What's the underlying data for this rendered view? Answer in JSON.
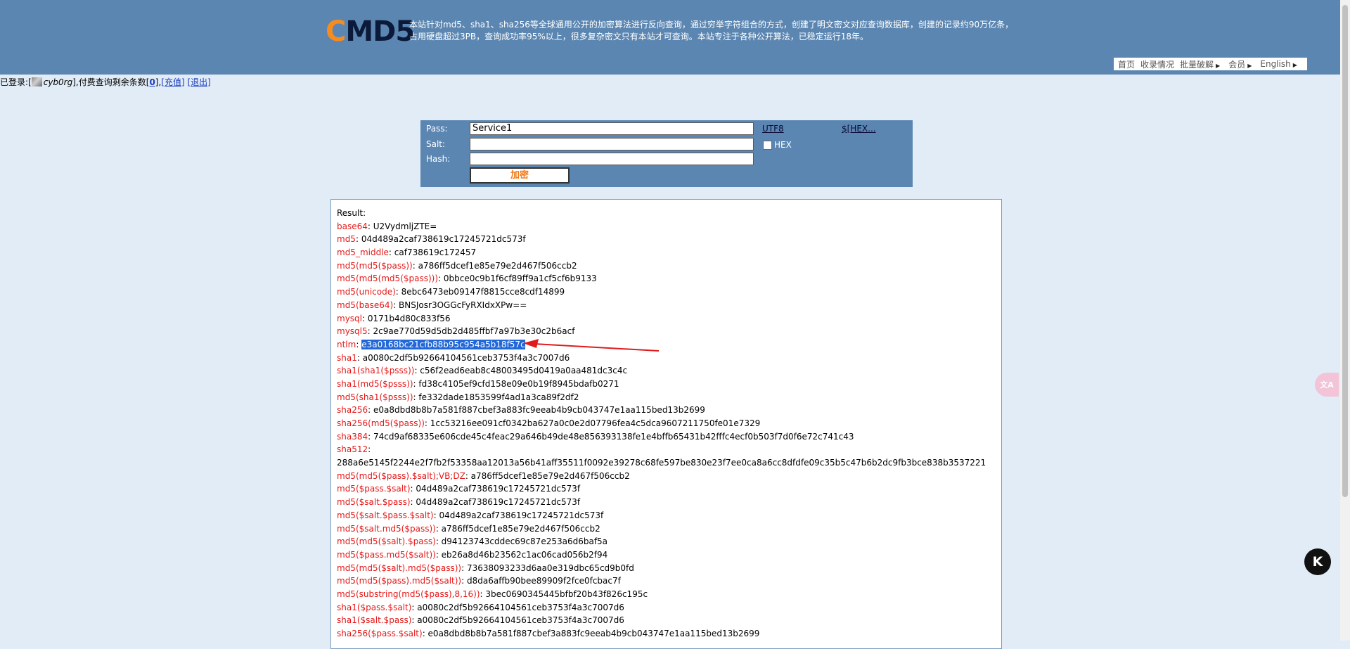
{
  "header": {
    "logo_first": "C",
    "logo_rest": "MD5",
    "desc_line1": "本站针对md5、sha1、sha256等全球通用公开的加密算法进行反向查询，通过穷举字符组合的方式，创建了明文密文对应查询数据库，创建的记录约90万亿条，",
    "desc_line2": "占用硬盘超过3PB，查询成功率95%以上，很多复杂密文只有本站才可查询。本站专注于各种公开算法，已稳定运行18年。"
  },
  "nav": {
    "home": "首页",
    "collect": "收录情况",
    "batch": "批量破解",
    "member": "会员",
    "english": "English"
  },
  "login": {
    "prefix": "已登录:[",
    "username": "cyb0rg",
    "middle": "],付费查询剩余条数[",
    "count": "0",
    "sep": "],",
    "recharge": "[充值]",
    "logout": "[退出]"
  },
  "form": {
    "pass_label": "Pass:",
    "pass_value": "Service1",
    "salt_label": "Salt:",
    "salt_value": "",
    "hash_label": "Hash:",
    "hash_value": "",
    "utf8_link": "UTF8",
    "hex_link": "$[HEX...",
    "hex_checkbox": "HEX",
    "encrypt_button": "加密"
  },
  "result": {
    "title": "Result:",
    "rows": [
      {
        "k": "base64",
        "v": "U2VydmljZTE="
      },
      {
        "k": "md5",
        "v": "04d489a2caf738619c17245721dc573f"
      },
      {
        "k": "md5_middle",
        "v": "caf738619c172457"
      },
      {
        "k": "md5(md5($pass))",
        "v": "a786ff5dcef1e85e79e2d467f506ccb2"
      },
      {
        "k": "md5(md5(md5($pass)))",
        "v": "0bbce0c9b1f6cf89ff9a1cf5cf6b9133"
      },
      {
        "k": "md5(unicode)",
        "v": "8ebc6473eb09147f8815cce8cdf14899"
      },
      {
        "k": "md5(base64)",
        "v": "BNSJosr3OGGcFyRXIdxXPw=="
      },
      {
        "k": "mysql",
        "v": "0171b4d80c833f56"
      },
      {
        "k": "mysql5",
        "v": "2c9ae770d59d5db2d485ffbf7a97b3e30c2b6acf"
      },
      {
        "k": "ntlm",
        "v": "e3a0168bc21cfb88b95c954a5b18f57c"
      },
      {
        "k": "sha1",
        "v": "a0080c2df5b92664104561ceb3753f4a3c7007d6"
      },
      {
        "k": "sha1(sha1($psss))",
        "v": "c56f2ead6eab8c48003495d0419a0aa481dc3c4c"
      },
      {
        "k": "sha1(md5($psss))",
        "v": "fd38c4105ef9cfd158e09e0b19f8945bdafb0271"
      },
      {
        "k": "md5(sha1($psss))",
        "v": "fe332dade1853599f4ad1a3ca89f2df2"
      },
      {
        "k": "sha256",
        "v": "e0a8dbd8b8b7a581f887cbef3a883fc9eeab4b9cb043747e1aa115bed13b2699"
      },
      {
        "k": "sha256(md5($pass))",
        "v": "1cc53216ee091cf0342ba627a0c0e2d07796fea4c5dca9607211750fe01e7329"
      },
      {
        "k": "sha384",
        "v": "74cd9af68335e606cde45c4feac29a646b49de48e856393138fe1e4bffb65431b42fffc4ecf0b503f7d0f6e72c741c43"
      },
      {
        "k": "sha512",
        "v": ""
      },
      {
        "k": "",
        "v": "288a6e5145f2244e2f7fb2f53358aa12013a56b41aff35511f0092e39278c68fe597be830e23f7ee0ca8a6cc8dfdfe09c35b5c47b6b2dc9fb3bce838b3537221"
      },
      {
        "k": "md5(md5($pass).$salt);VB;DZ",
        "v": "a786ff5dcef1e85e79e2d467f506ccb2"
      },
      {
        "k": "md5($pass.$salt)",
        "v": "04d489a2caf738619c17245721dc573f"
      },
      {
        "k": "md5($salt.$pass)",
        "v": "04d489a2caf738619c17245721dc573f"
      },
      {
        "k": "md5($salt.$pass.$salt)",
        "v": "04d489a2caf738619c17245721dc573f"
      },
      {
        "k": "md5($salt.md5($pass))",
        "v": "a786ff5dcef1e85e79e2d467f506ccb2"
      },
      {
        "k": "md5(md5($salt).$pass)",
        "v": "d94123743cddec69c87e253a6d6baf5a"
      },
      {
        "k": "md5($pass.md5($salt))",
        "v": "eb26a8d46b23562c1ac06cad056b2f94"
      },
      {
        "k": "md5(md5($salt).md5($pass))",
        "v": "73638093233d6aa0e319dbc65cd9b0fd"
      },
      {
        "k": "md5(md5($pass).md5($salt))",
        "v": "d8da6affb90bee89909f2fce0fcbac7f"
      },
      {
        "k": "md5(substring(md5($pass),8,16))",
        "v": "3bec0690345445bfbf20b43f826c195c"
      },
      {
        "k": "sha1($pass.$salt)",
        "v": "a0080c2df5b92664104561ceb3753f4a3c7007d6"
      },
      {
        "k": "sha1($salt.$pass)",
        "v": "a0080c2df5b92664104561ceb3753f4a3c7007d6"
      },
      {
        "k": "sha256($pass.$salt)",
        "v": "e0a8dbd8b8b7a581f887cbef3a883fc9eeab4b9cb043747e1aa115bed13b2699"
      }
    ],
    "highlight_key": "ntlm"
  },
  "widgets": {
    "translate_icon": "translate-icon",
    "translate_glyph": "文A",
    "k_icon": "k-logo-icon",
    "k_glyph": "K"
  },
  "colors": {
    "header_bg": "#5b86b1",
    "page_bg": "#e1ecf6",
    "key_red": "#e61717",
    "logo_orange": "#f78b1d",
    "selection": "#2167d8"
  }
}
